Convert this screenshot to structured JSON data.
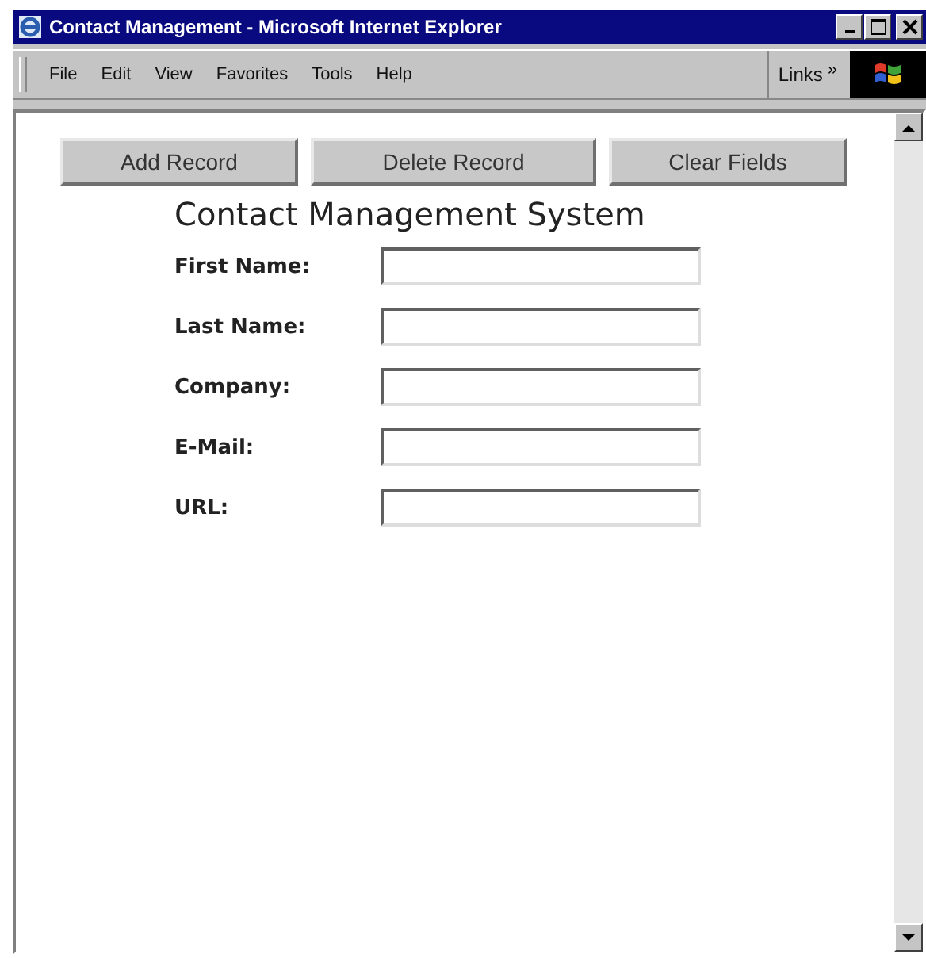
{
  "window": {
    "title": "Contact Management - Microsoft Internet Explorer"
  },
  "menu": [
    "File",
    "Edit",
    "View",
    "Favorites",
    "Tools",
    "Help"
  ],
  "links": {
    "label": "Links",
    "chevron": "»"
  },
  "buttons": [
    "Add Record",
    "Delete Record",
    "Clear Fields"
  ],
  "form": {
    "heading": "Contact Management System",
    "fields": [
      {
        "label": "First Name:"
      },
      {
        "label": "Last Name:"
      },
      {
        "label": "Company:"
      },
      {
        "label": "E-Mail:"
      },
      {
        "label": "URL:"
      }
    ]
  }
}
